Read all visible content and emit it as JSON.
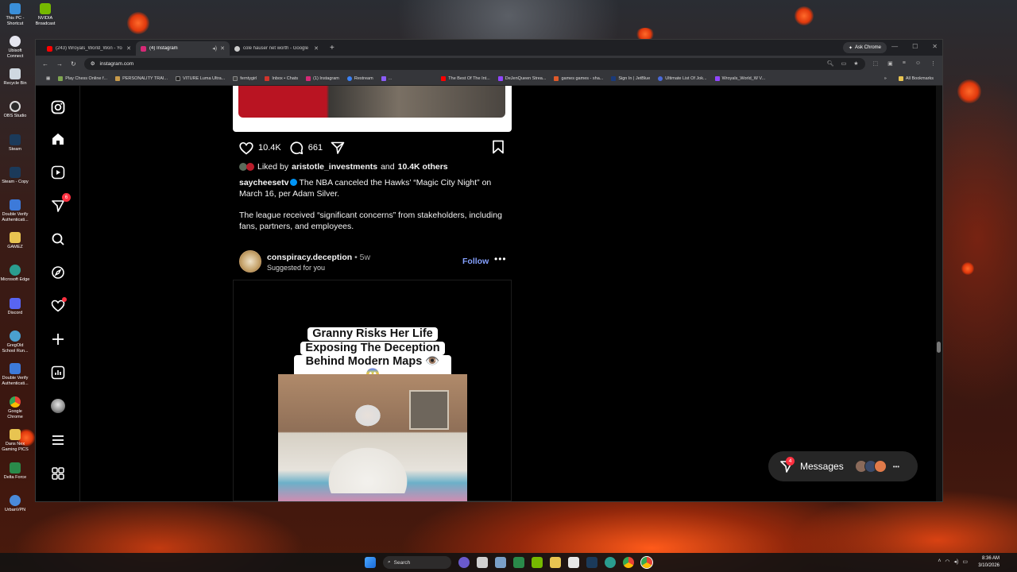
{
  "desktop": {
    "icons": [
      {
        "label": "This PC - Shortcut",
        "color": "#3a8fd9"
      },
      {
        "label": "Ubisoft Connect",
        "color": "#e6e6f0"
      },
      {
        "label": "Recycle Bin",
        "color": "#cfd8e0"
      },
      {
        "label": "OBS Studio",
        "color": "#2b2b2b"
      },
      {
        "label": "Steam",
        "color": "#1b3a5a"
      },
      {
        "label": "Steam - Copy",
        "color": "#1b3a5a"
      },
      {
        "label": "Double Verify Authenticati...",
        "color": "#3d7ad9"
      },
      {
        "label": "GAMEZ",
        "color": "#e8c451"
      },
      {
        "label": "Microsoft Edge",
        "color": "#2a9d8f"
      },
      {
        "label": "Discord",
        "color": "#5865f2"
      },
      {
        "label": "GregOld School Run...",
        "color": "#4aa0d0"
      },
      {
        "label": "Double Verify Authenticati...",
        "color": "#3d7ad9"
      },
      {
        "label": "Google Chrome",
        "color": "#e94235"
      },
      {
        "label": "Dans Nex Gaming PICS",
        "color": "#e8c451"
      },
      {
        "label": "Delta Force",
        "color": "#2a8a4a"
      },
      {
        "label": "UrbanVPN",
        "color": "#4a8ad9"
      }
    ],
    "nvidia_label": "NVIDIA Broadcast"
  },
  "browser": {
    "tabs": [
      {
        "title": "(243) Wroyals_World_Won - Yo",
        "color": "#ff0000"
      },
      {
        "title": "(4) Instagram",
        "color": "#d62976"
      },
      {
        "title": "cole hauser net worth - Google",
        "color": "#cccccc"
      }
    ],
    "new_tab": "+",
    "ask_chrome": "Ask Chrome",
    "url": "instagram.com",
    "bookmarks": [
      {
        "label": "Play Chess Online f...",
        "color": "#7fa650"
      },
      {
        "label": "PERSONALITY TRAI...",
        "color": "#c89a4a"
      },
      {
        "label": "VITURE Luma Ultra...",
        "color": "#222222"
      },
      {
        "label": "ferntygirl",
        "color": "#444444"
      },
      {
        "label": "Inbox • Chats",
        "color": "#d0342c"
      },
      {
        "label": "(1) Instagram",
        "color": "#d62976"
      },
      {
        "label": "Restream",
        "color": "#3b82f6"
      },
      {
        "label": "...",
        "color": "#8b5cf6"
      },
      {
        "label": "The Best Of The Int...",
        "color": "#ff0000"
      },
      {
        "label": "DeJenQueen Strea...",
        "color": "#9146ff"
      },
      {
        "label": "games games - sha...",
        "color": "#e05a2a"
      },
      {
        "label": "Sign In | JetBlue",
        "color": "#1a3a7a"
      },
      {
        "label": "Ultimate List Of Jok...",
        "color": "#4a6ad9"
      },
      {
        "label": "Wroyals_World_W V...",
        "color": "#9146ff"
      }
    ],
    "all_bookmarks": "All Bookmarks"
  },
  "instagram": {
    "nav": {
      "notifications_badge": "6"
    },
    "post1": {
      "likes_count": "10.4K",
      "comments_count": "661",
      "liked_by_prefix": "Liked by",
      "liked_by_user": "aristotle_investments",
      "liked_by_and": "and",
      "liked_by_others": "10.4K others",
      "author": "saycheesetv",
      "caption_1": "The NBA canceled the Hawks’ “Magic City Night” on March 16, per Adam Silver.",
      "caption_2": "The league received “significant concerns” from stakeholders, including fans, partners, and employees."
    },
    "post2": {
      "author": "conspiracy.deception",
      "age": "• 5w",
      "subtitle": "Suggested for you",
      "follow": "Follow",
      "more": "•••",
      "headline_1": "Granny Risks Her Life",
      "headline_2": "Exposing The Deception",
      "headline_3": "Behind Modern Maps 👁️😱"
    },
    "messages": {
      "label": "Messages",
      "badge": "4",
      "more": "•••"
    }
  },
  "taskbar": {
    "search": "Search",
    "time": "8:36 AM",
    "date": "3/10/2026"
  }
}
